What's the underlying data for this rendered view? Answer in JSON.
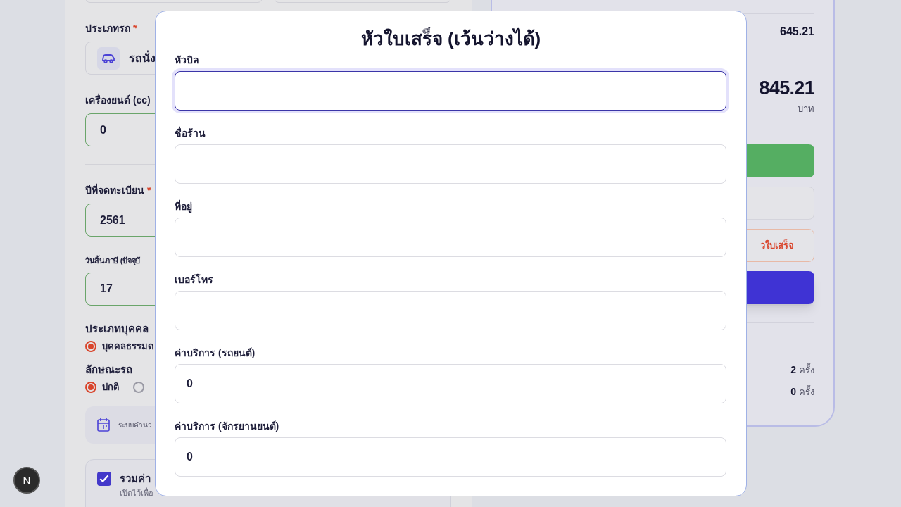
{
  "form": {
    "vehicle_type": {
      "label": "ประเภทรถ",
      "mark": "*",
      "value": "รถนั่ง"
    },
    "engine": {
      "label": "เครื่องยนต์ (cc)",
      "value": "0"
    },
    "reg_year": {
      "label": "ปีที่จดทะเบียน",
      "mark": "*",
      "value": "2561"
    },
    "tax_expiry": {
      "label": "วันสิ้นภาษี (ปัจจุบั",
      "value": "17"
    },
    "person_type": {
      "label": "ประเภทบุคคล",
      "options": [
        {
          "label": "บุคคลธรรมด",
          "selected": true
        }
      ]
    },
    "vehicle_kind": {
      "label": "ลักษณะรถ",
      "options": [
        {
          "label": "ปกติ",
          "selected": true
        },
        {
          "selected": false
        }
      ]
    },
    "info_note": "ระบบคำนว",
    "include_option": {
      "label": "รวมค่า",
      "description": "เปิดไว้เพื่อ",
      "checked": true
    }
  },
  "summary": {
    "subtotal": "645.21",
    "total": "845.21",
    "currency": "บาท",
    "buttons": [
      {
        "kind": "success"
      },
      {
        "kind": "plain"
      },
      {
        "kind": "outline",
        "label": "วใบเสร็จ"
      },
      {
        "kind": "primary"
      }
    ],
    "counts": [
      {
        "value": "2",
        "unit": "ครั้ง"
      },
      {
        "value": "0",
        "unit": "ครั้ง"
      }
    ]
  },
  "modal": {
    "title": "หัวใบเสร็จ (เว้นว่างได้)",
    "fields": [
      {
        "label": "หัวบิล",
        "focused": true
      },
      {
        "label": "ชื่อร้าน",
        "focused": false
      },
      {
        "label": "ที่อยู่",
        "focused": false
      },
      {
        "label": "เบอร์โทร",
        "focused": false
      },
      {
        "label": "ค่าบริการ (รถยนต์)",
        "value": "0",
        "focused": false
      },
      {
        "label": "ค่าบริการ (จักรยานยนต์)",
        "value": "0",
        "focused": false
      }
    ]
  },
  "badge": "N"
}
